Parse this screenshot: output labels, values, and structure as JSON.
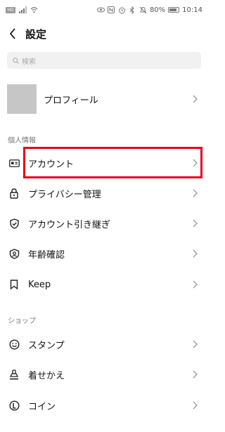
{
  "status_bar": {
    "sim_label": "HD",
    "battery_percent": "80%",
    "time": "10:14"
  },
  "header": {
    "title": "設定"
  },
  "search": {
    "placeholder": "検索"
  },
  "profile": {
    "label": "プロフィール"
  },
  "sections": {
    "personal": "個人情報",
    "shop": "ショップ"
  },
  "personal_items": [
    {
      "label": "アカウント",
      "icon": "id-card-icon"
    },
    {
      "label": "プライバシー管理",
      "icon": "lock-icon"
    },
    {
      "label": "アカウント引き継ぎ",
      "icon": "shield-check-icon"
    },
    {
      "label": "年齢確認",
      "icon": "age-verification-icon"
    },
    {
      "label": "Keep",
      "icon": "bookmark-icon"
    }
  ],
  "shop_items": [
    {
      "label": "スタンプ",
      "icon": "smiley-icon"
    },
    {
      "label": "着せかえ",
      "icon": "brush-icon"
    },
    {
      "label": "コイン",
      "icon": "coin-icon"
    }
  ],
  "colors": {
    "highlight": "#e8001c",
    "avatar_placeholder": "#c6c6c6",
    "search_bg": "#f1f1f1"
  }
}
